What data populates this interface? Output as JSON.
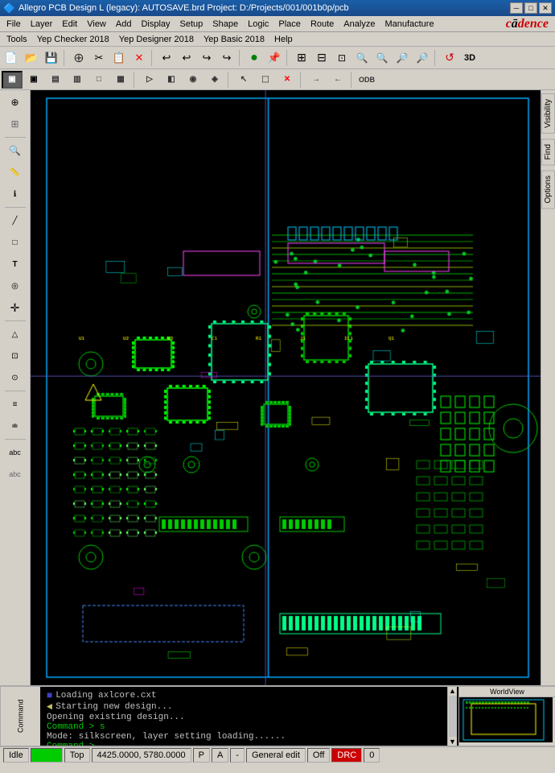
{
  "titleBar": {
    "icon": "🔷",
    "text": "Allegro PCB Design L (legacy): AUTOSAVE.brd  Project: D:/Projects/001/001b0p/pcb",
    "minimize": "─",
    "restore": "□",
    "close": "✕"
  },
  "menuBar": {
    "items": [
      "File",
      "Layer",
      "Edit",
      "View",
      "Add",
      "Display",
      "Setup",
      "Shape",
      "Logic",
      "Place",
      "Route",
      "Analyze",
      "Manufacture",
      "Tools",
      "Yep Checker 2018",
      "Yep Designer 2018",
      "Yep Basic 2018",
      "Help"
    ]
  },
  "rightTabs": [
    "Visibility",
    "Find",
    "Options"
  ],
  "console": {
    "lines": [
      {
        "type": "bullet",
        "text": "Loading axlcore.cxt"
      },
      {
        "type": "arrow",
        "text": "Starting new design..."
      },
      {
        "type": "plain",
        "text": "Opening existing design..."
      },
      {
        "type": "prompt",
        "text": "Command > s"
      },
      {
        "type": "plain",
        "text": "Mode: silkscreen, layer setting loading......"
      },
      {
        "type": "prompt",
        "text": "Command >"
      }
    ]
  },
  "worldview": {
    "label": "WorldView"
  },
  "statusBar": {
    "state": "Idle",
    "greenIndicator": "",
    "layer": "Top",
    "coords": "4425.0000, 5780.0000",
    "padstack": "P",
    "alignMode": "A",
    "dash": "-",
    "mode": "General edit",
    "off": "Off",
    "red": "DRC",
    "zero": "0"
  }
}
